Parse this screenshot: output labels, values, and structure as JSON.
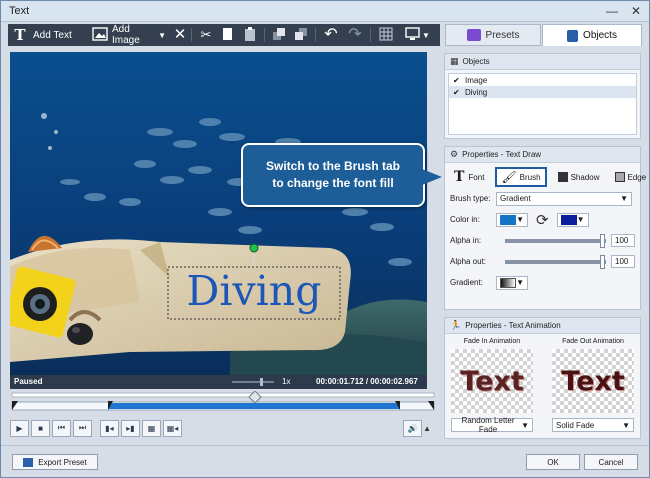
{
  "window": {
    "title": "Text"
  },
  "toolbar": {
    "add_text": "Add Text",
    "add_image": "Add Image"
  },
  "tabs": {
    "presets": "Presets",
    "objects": "Objects"
  },
  "preview": {
    "text": "Diving",
    "status": "Paused",
    "speed": "1x",
    "time": "00:00:01.712 / 00:00:02.967"
  },
  "objects_panel": {
    "title": "Objects",
    "items": [
      {
        "label": "Image",
        "checked": true
      },
      {
        "label": "Diving",
        "checked": true
      }
    ]
  },
  "text_draw_panel": {
    "title": "Properties - Text Draw",
    "subtabs": {
      "font": "Font",
      "brush": "Brush",
      "shadow": "Shadow",
      "edge": "Edge"
    },
    "brush_type_label": "Brush type:",
    "brush_type_value": "Gradient",
    "color_in_label": "Color in:",
    "color_in_1": "#1574c7",
    "color_in_2": "#0a1e9e",
    "alpha_in_label": "Alpha in:",
    "alpha_in_value": "100",
    "alpha_out_label": "Alpha out:",
    "alpha_out_value": "100",
    "gradient_label": "Gradient:"
  },
  "text_animation_panel": {
    "title": "Properties - Text Animation",
    "fade_in_title": "Fade In Animation",
    "fade_out_title": "Fade Out Animation",
    "fade_in_preview_text": "Text",
    "fade_out_preview_text": "Text",
    "fade_in_value": "Random Letter Fade",
    "fade_out_value": "Solid Fade"
  },
  "footer": {
    "export_preset": "Export Preset",
    "ok": "OK",
    "cancel": "Cancel"
  },
  "callout": {
    "line1": "Switch to the Brush tab",
    "line2": "to change the font fill"
  }
}
